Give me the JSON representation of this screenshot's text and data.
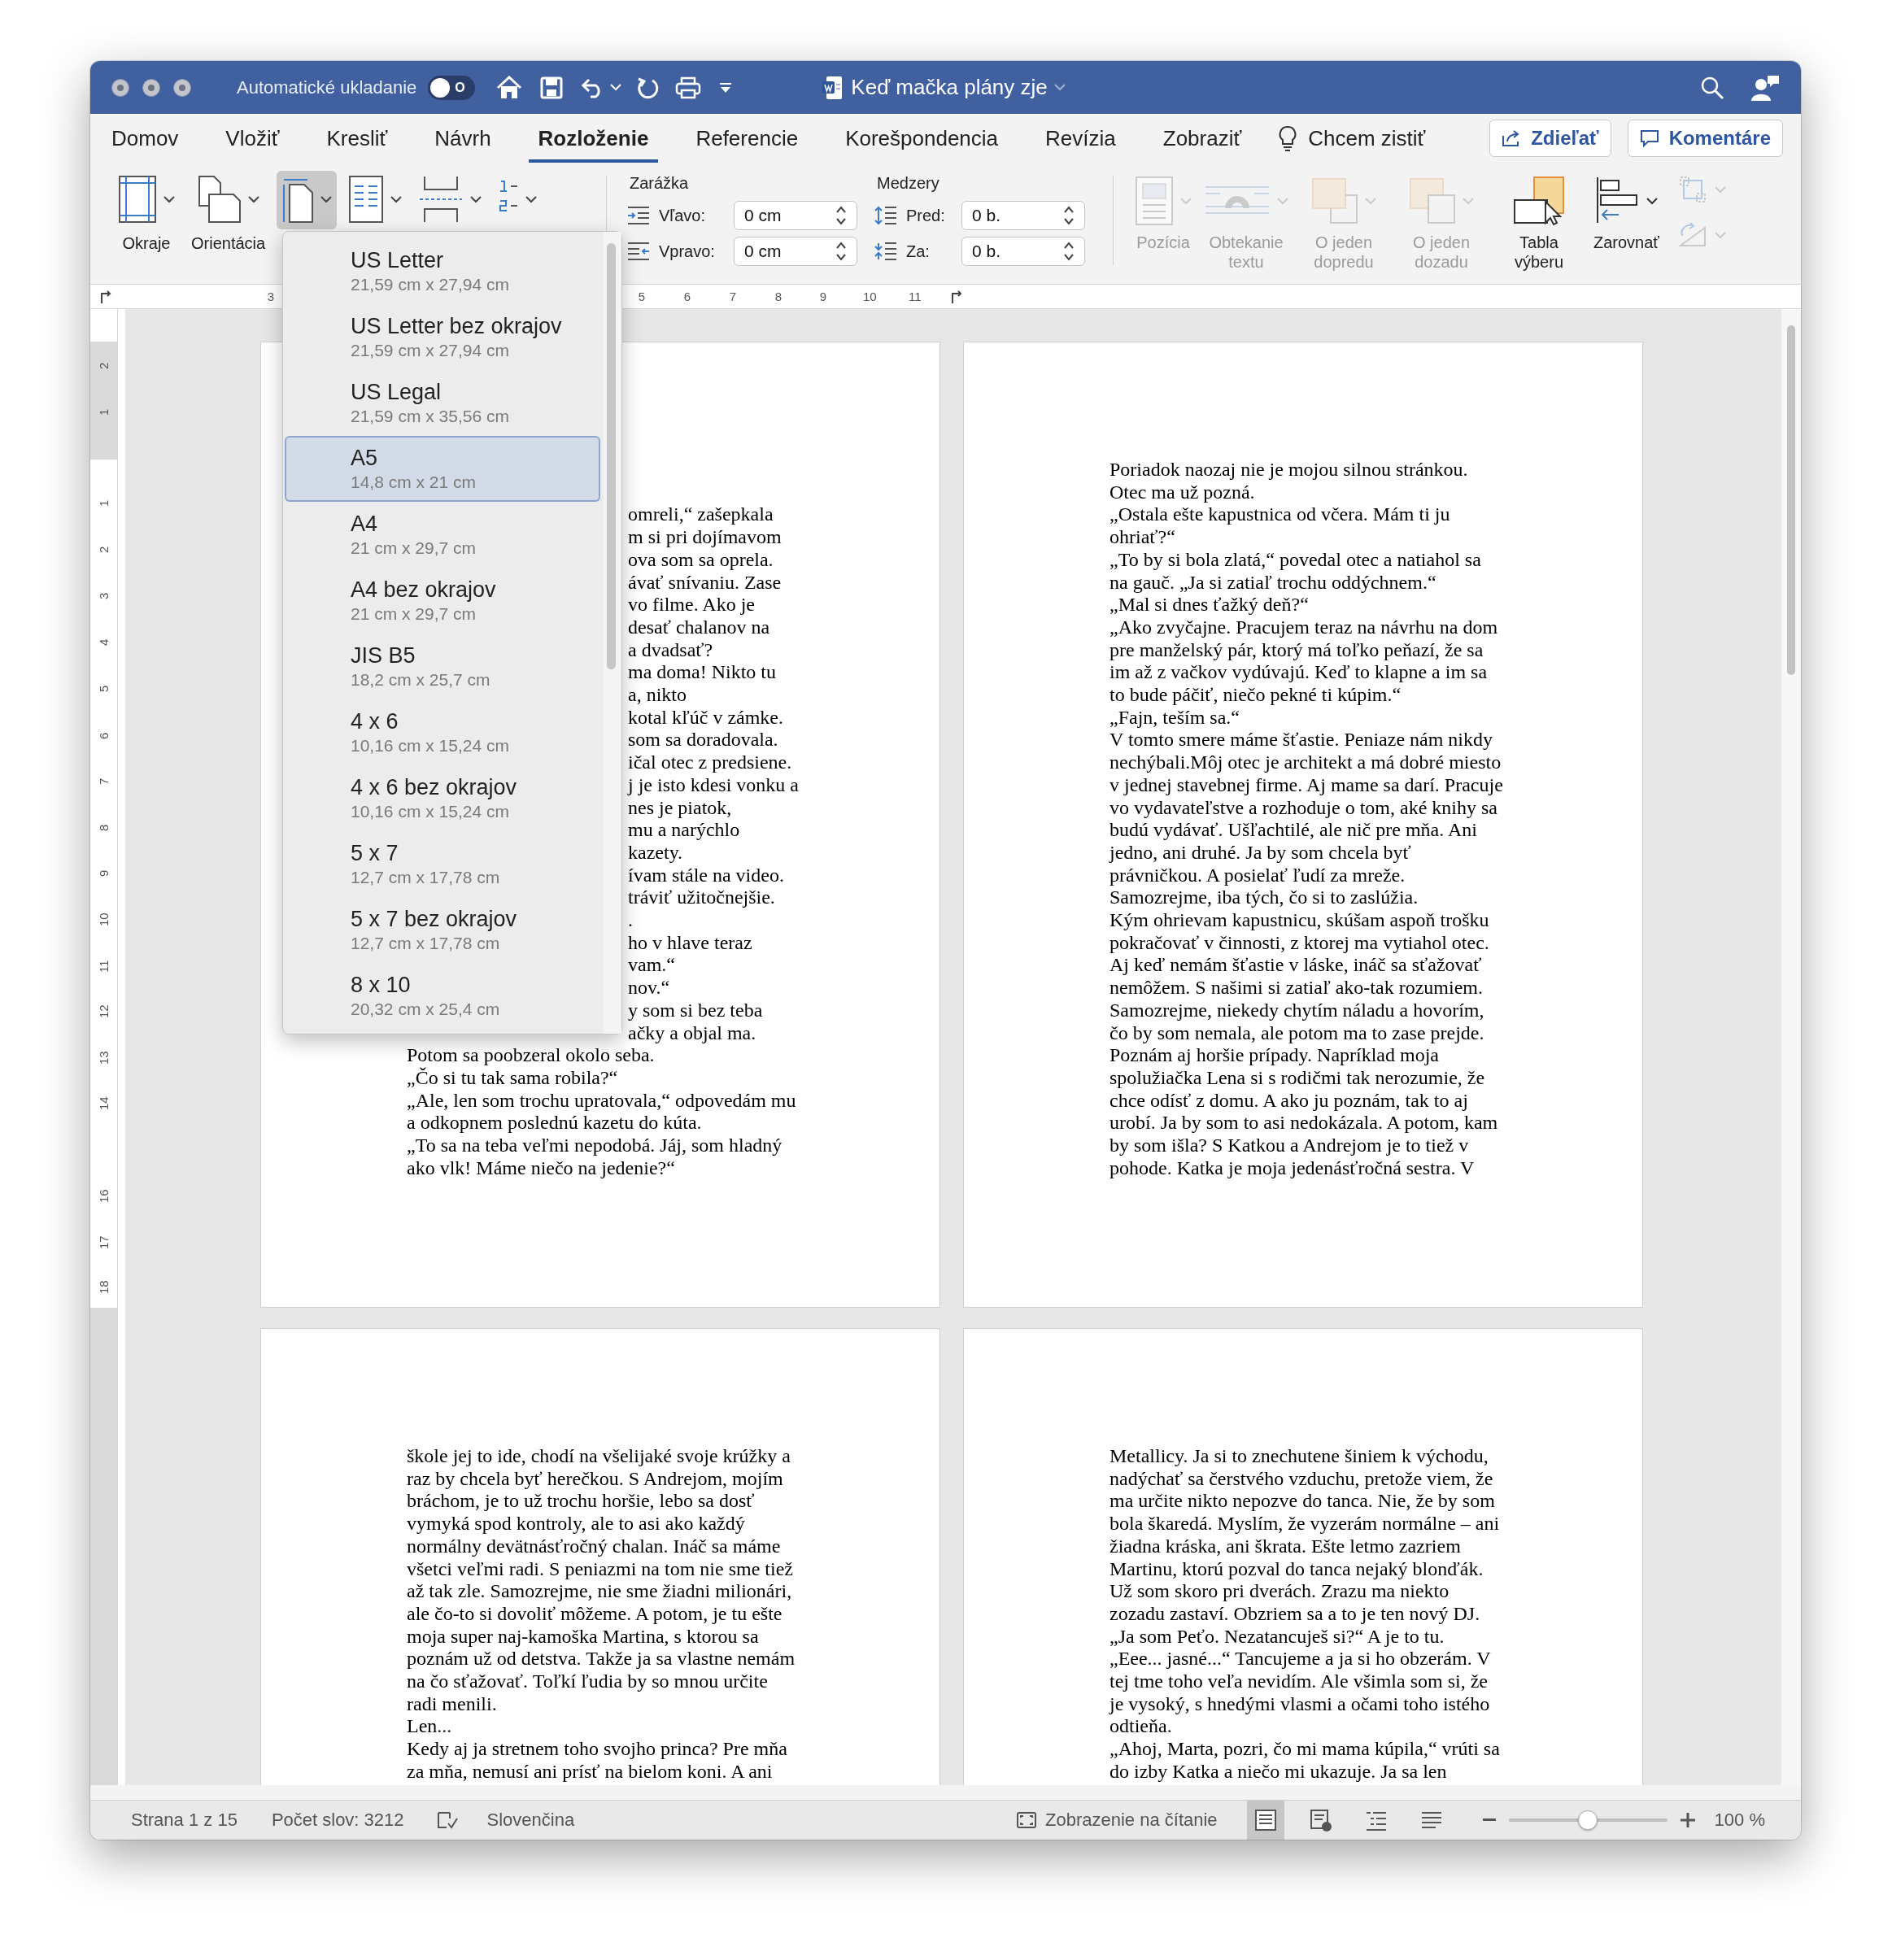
{
  "title_bar": {
    "autosave_label": "Automatické ukladanie",
    "autosave": {
      "on": false,
      "label": "O"
    },
    "document_title": "Keď mačka plány zje"
  },
  "ribbon_tabs": [
    {
      "label": "Domov",
      "selected": false
    },
    {
      "label": "Vložiť",
      "selected": false
    },
    {
      "label": "Kresliť",
      "selected": false
    },
    {
      "label": "Návrh",
      "selected": false
    },
    {
      "label": "Rozloženie",
      "selected": true
    },
    {
      "label": "Referencie",
      "selected": false
    },
    {
      "label": "Korešpondencia",
      "selected": false
    },
    {
      "label": "Revízia",
      "selected": false
    },
    {
      "label": "Zobraziť",
      "selected": false
    }
  ],
  "tell_me": "Chcem zistiť",
  "share_button": "Zdieľať",
  "comments_button": "Komentáre",
  "ribbon": {
    "page_setup": [
      {
        "kind": "margins",
        "label": "Okraje",
        "pressed": false
      },
      {
        "kind": "orientation",
        "label": "Orientácia",
        "pressed": false
      },
      {
        "kind": "size",
        "pressed": true
      },
      {
        "kind": "columns",
        "pressed": false
      },
      {
        "kind": "breaks",
        "pressed": false
      },
      {
        "kind": "line_numbers",
        "pressed": false
      }
    ],
    "indent": {
      "title": "Zarážka",
      "fields": [
        {
          "kind": "left",
          "label": "Vľavo:",
          "value": "0 cm"
        },
        {
          "kind": "right",
          "label": "Vpravo:",
          "value": "0 cm"
        }
      ]
    },
    "spacing": {
      "title": "Medzery",
      "fields": [
        {
          "kind": "before",
          "label": "Pred:",
          "value": "0 b."
        },
        {
          "kind": "after",
          "label": "Za:",
          "value": "0 b."
        }
      ]
    },
    "arrange": [
      {
        "kind": "position",
        "label": "Pozícia",
        "disabled": true
      },
      {
        "kind": "wrap",
        "label": "Obtekanie textu",
        "disabled": true
      },
      {
        "kind": "forward",
        "label": "O jeden dopredu",
        "disabled": true
      },
      {
        "kind": "backward",
        "label": "O jeden dozadu",
        "disabled": true
      },
      {
        "kind": "selection_pane",
        "label": "Tabla výberu",
        "disabled": false
      },
      {
        "kind": "align",
        "label": "Zarovnať",
        "disabled": false
      },
      {
        "kind": "group",
        "disabled": true
      },
      {
        "kind": "rotate",
        "disabled": true
      }
    ]
  },
  "horizontal_ruler": [
    "3",
    "5",
    "6",
    "7",
    "8",
    "9",
    "10",
    "11"
  ],
  "vertical_ruler": [
    "2",
    "1",
    "1",
    "2",
    "3",
    "4",
    "5",
    "6",
    "7",
    "8",
    "9",
    "10",
    "11",
    "12",
    "13",
    "14",
    "16",
    "17",
    "18"
  ],
  "page_rows": [
    {
      "pages": [
        {
          "kind": "covered",
          "fragments": [
            "omreli,“ zašepkala",
            "m si pri dojímavom",
            "ova som sa oprela.",
            "ávať snívaniu. Zase",
            "vo filme. Ako je",
            "desať chalanov na",
            "a dvadsať?",
            "ma doma! Nikto tu",
            "a, nikto",
            "kotal kľúč v zámke.",
            "som sa doradovala.",
            "ičal otec z predsiene.",
            "j je isto kdesi vonku a",
            "nes je piatok,",
            "mu a narýchlo",
            "kazety.",
            "ívam stále na video.",
            "tráviť užitočnejšie.",
            ".",
            "ho v hlave teraz",
            "vam.“",
            "nov.“",
            "y som si bez teba",
            "ačky a objal ma."
          ],
          "paragraphs": [
            "Potom sa poobzeral okolo seba.",
            "„Čo si tu tak sama robila?“",
            "„Ale, len som trochu upratovala,“ odpovedám mu a odkopnem poslednú kazetu do kúta.",
            "„To sa na teba veľmi nepodobá. Jáj, som hladný ako vlk! Máme niečo na jedenie?“"
          ]
        },
        {
          "kind": "plain",
          "paragraphs": [
            "Poriadok naozaj nie je mojou silnou stránkou.",
            "Otec ma už pozná.",
            "„Ostala ešte kapustnica od včera. Mám ti ju ohriať?“",
            "„To by si bola zlatá,“ povedal otec a natiahol sa na gauč. „Ja si zatiaľ trochu oddýchnem.“",
            "„Mal si dnes ťažký deň?“",
            "„Ako zvyčajne. Pracujem teraz na návrhu na dom pre manželský pár, ktorý má toľko peňazí, že sa im až z vačkov vydúvajú. Keď to klapne a im sa to bude páčiť, niečo pekné ti kúpim.“",
            "„Fajn, teším sa.“",
            "V tomto smere máme šťastie. Peniaze nám nikdy nechýbali.Môj otec je architekt a má dobré miesto v jednej stavebnej firme. Aj mame sa darí. Pracuje vo vydavateľstve a rozhoduje o tom, aké knihy sa budú vydávať. Ušľachtilé, ale nič pre mňa. Ani jedno, ani druhé. Ja by som chcela byť právničkou. A posielať ľudí za mreže.",
            "Samozrejme, iba tých, čo si to zaslúžia.",
            "Kým ohrievam kapustnicu, skúšam aspoň trošku pokračovať v činnosti, z ktorej ma vytiahol otec.",
            "Aj keď nemám šťastie v láske, ináč sa sťažovať nemôžem. S našimi si zatiaľ ako-tak rozumiem. Samozrejme, niekedy chytím náladu a hovorím, čo by som nemala, ale potom ma to zase prejde.",
            "Poznám aj horšie prípady. Napríklad moja spolužiačka Lena si s rodičmi tak nerozumie, že chce odísť z domu. A ako ju poznám, tak to aj urobí. Ja by som to asi nedokázala. A potom, kam by som išla? S Katkou a Andrejom je to tiež v pohode. Katka je moja jedenásťročná sestra. V"
          ]
        }
      ]
    },
    {
      "pages": [
        {
          "kind": "plain",
          "paragraphs": [
            "škole jej to ide, chodí na všelijaké svoje krúžky a raz by chcela byť herečkou. S Andrejom, mojím bráchom, je to už trochu horšie, lebo sa dosť vymyká spod kontroly, ale to asi ako každý normálny devätnásťročný chalan. Ináč sa máme všetci veľmi radi. S peniazmi na tom nie sme tiež až tak zle. Samozrejme, nie sme žiadni milionári, ale čo-to si dovoliť môžeme. A potom, je tu ešte moja super naj-kamoška Martina, s ktorou sa poznám už od detstva. Takže ja sa vlastne nemám na čo sťažovať. Toľkí ľudia by so mnou určite radi menili.",
            "Len...",
            "Kedy aj ja stretnem toho svojho princa? Pre mňa za mňa, nemusí ani prísť na bielom koni. A ani"
          ]
        },
        {
          "kind": "plain",
          "paragraphs": [
            "Metallicy. Ja si to znechutene šiniem k východu, nadýchať sa čerstvého vzduchu, pretože viem, že ma určite nikto nepozve do tanca. Nie, že by som bola škaredá. Myslím, že vyzerám normálne – ani žiadna kráska, ani škrata. Ešte letmo zazriem Martinu, ktorú pozval do tanca nejaký blonďák. Už som skoro pri dverách. Zrazu ma niekto zozadu zastaví. Obzriem sa a to je ten nový DJ.",
            "„Ja som Peťo. Nezatancuješ si?“ A je to tu.",
            "„Eee... jasné...“ Tancujeme a ja si ho obzerám. V tej tme toho veľa nevidím. Ale všimla som si, že je vysoký, s hnedými vlasmi a očami toho istého odtieňa.",
            "„Ahoj, Marta, pozri, čo mi mama kúpila,“ vrúti sa do izby Katka a niečo mi ukazuje. Ja sa len"
          ]
        }
      ]
    }
  ],
  "page_size_menu": {
    "items": [
      {
        "name": "US Letter",
        "size": "21,59 cm x 27,94 cm",
        "selected": false
      },
      {
        "name": "US Letter bez okrajov",
        "size": "21,59 cm x 27,94 cm",
        "selected": false
      },
      {
        "name": "US Legal",
        "size": "21,59 cm x 35,56 cm",
        "selected": false
      },
      {
        "name": "A5",
        "size": "14,8 cm x 21 cm",
        "selected": true
      },
      {
        "name": "A4",
        "size": "21 cm x 29,7 cm",
        "selected": false
      },
      {
        "name": "A4 bez okrajov",
        "size": "21 cm x 29,7 cm",
        "selected": false
      },
      {
        "name": "JIS B5",
        "size": "18,2 cm x 25,7 cm",
        "selected": false
      },
      {
        "name": "4 x 6",
        "size": "10,16 cm x 15,24 cm",
        "selected": false
      },
      {
        "name": "4 x 6 bez okrajov",
        "size": "10,16 cm x 15,24 cm",
        "selected": false
      },
      {
        "name": "5 x 7",
        "size": "12,7 cm x 17,78 cm",
        "selected": false
      },
      {
        "name": "5 x 7 bez okrajov",
        "size": "12,7 cm x 17,78 cm",
        "selected": false
      },
      {
        "name": "8 x 10",
        "size": "20,32 cm x 25,4 cm",
        "selected": false
      }
    ]
  },
  "status_bar": {
    "page": "Strana 1 z 15",
    "word_count": "Počet slov: 3212",
    "language": "Slovenčina",
    "focus": "Zobrazenie na čítanie",
    "views": [
      {
        "kind": "print",
        "selected": true
      },
      {
        "kind": "web",
        "selected": false
      },
      {
        "kind": "outline",
        "selected": false
      },
      {
        "kind": "draft",
        "selected": false
      }
    ],
    "zoom": {
      "level": 0.5,
      "value": "100 %"
    }
  }
}
